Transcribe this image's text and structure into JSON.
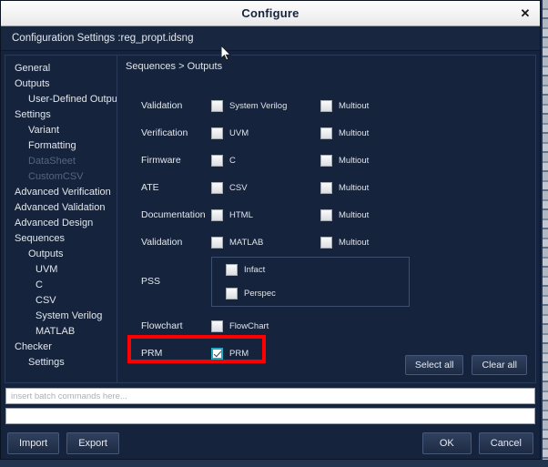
{
  "window": {
    "title": "Configure",
    "close_icon": "close-icon",
    "subheader": "Configuration Settings :reg_propt.idsng"
  },
  "sidebar": {
    "items": [
      {
        "label": "General",
        "level": 1,
        "disabled": false
      },
      {
        "label": "Outputs",
        "level": 1,
        "disabled": false
      },
      {
        "label": "User-Defined Outputs",
        "level": 2,
        "disabled": false
      },
      {
        "label": "Settings",
        "level": 1,
        "disabled": false
      },
      {
        "label": "Variant",
        "level": 2,
        "disabled": false
      },
      {
        "label": "Formatting",
        "level": 2,
        "disabled": false
      },
      {
        "label": "DataSheet",
        "level": 2,
        "disabled": true
      },
      {
        "label": "CustomCSV",
        "level": 2,
        "disabled": true
      },
      {
        "label": "Advanced Verification",
        "level": 1,
        "disabled": false
      },
      {
        "label": "Advanced Validation",
        "level": 1,
        "disabled": false
      },
      {
        "label": "Advanced Design",
        "level": 1,
        "disabled": false
      },
      {
        "label": "Sequences",
        "level": 1,
        "disabled": false
      },
      {
        "label": "Outputs",
        "level": 2,
        "disabled": false
      },
      {
        "label": "UVM",
        "level": 3,
        "disabled": false
      },
      {
        "label": "C",
        "level": 3,
        "disabled": false
      },
      {
        "label": "CSV",
        "level": 3,
        "disabled": false
      },
      {
        "label": "System Verilog",
        "level": 3,
        "disabled": false
      },
      {
        "label": "MATLAB",
        "level": 3,
        "disabled": false
      },
      {
        "label": "Checker",
        "level": 1,
        "disabled": false
      },
      {
        "label": "Settings",
        "level": 2,
        "disabled": false
      }
    ]
  },
  "panel": {
    "breadcrumb": "Sequences > Outputs",
    "rows": [
      {
        "label": "Validation",
        "primary": {
          "label": "System Verilog",
          "checked": false
        },
        "secondary": {
          "label": "Multiout",
          "checked": false
        }
      },
      {
        "label": "Verification",
        "primary": {
          "label": "UVM",
          "checked": false
        },
        "secondary": {
          "label": "Multiout",
          "checked": false
        }
      },
      {
        "label": "Firmware",
        "primary": {
          "label": "C",
          "checked": false
        },
        "secondary": {
          "label": "Multiout",
          "checked": false
        }
      },
      {
        "label": "ATE",
        "primary": {
          "label": "CSV",
          "checked": false
        },
        "secondary": {
          "label": "Multiout",
          "checked": false
        }
      },
      {
        "label": "Documentation",
        "primary": {
          "label": "HTML",
          "checked": false
        },
        "secondary": {
          "label": "Multiout",
          "checked": false
        }
      },
      {
        "label": "Validation",
        "primary": {
          "label": "MATLAB",
          "checked": false
        },
        "secondary": {
          "label": "Multiout",
          "checked": false
        }
      }
    ],
    "pss": {
      "label": "PSS",
      "options": [
        {
          "label": "Infact",
          "checked": false
        },
        {
          "label": "Perspec",
          "checked": false
        }
      ]
    },
    "flowchart": {
      "label": "Flowchart",
      "option": {
        "label": "FlowChart",
        "checked": false
      }
    },
    "prm": {
      "label": "PRM",
      "option": {
        "label": "PRM",
        "checked": true
      },
      "highlight_color": "#ff0000"
    },
    "select_all_label": "Select all",
    "clear_all_label": "Clear all"
  },
  "batch": {
    "command_placeholder": "insert batch commands here...",
    "command_value": "",
    "output_value": ""
  },
  "footer": {
    "import_label": "Import",
    "export_label": "Export",
    "ok_label": "OK",
    "cancel_label": "Cancel"
  },
  "theme": {
    "dialog_bg": "#15233d",
    "titlebar_bg": "#f2f2f2",
    "accent_check": "#21a8c4",
    "highlight": "#ff0000"
  }
}
